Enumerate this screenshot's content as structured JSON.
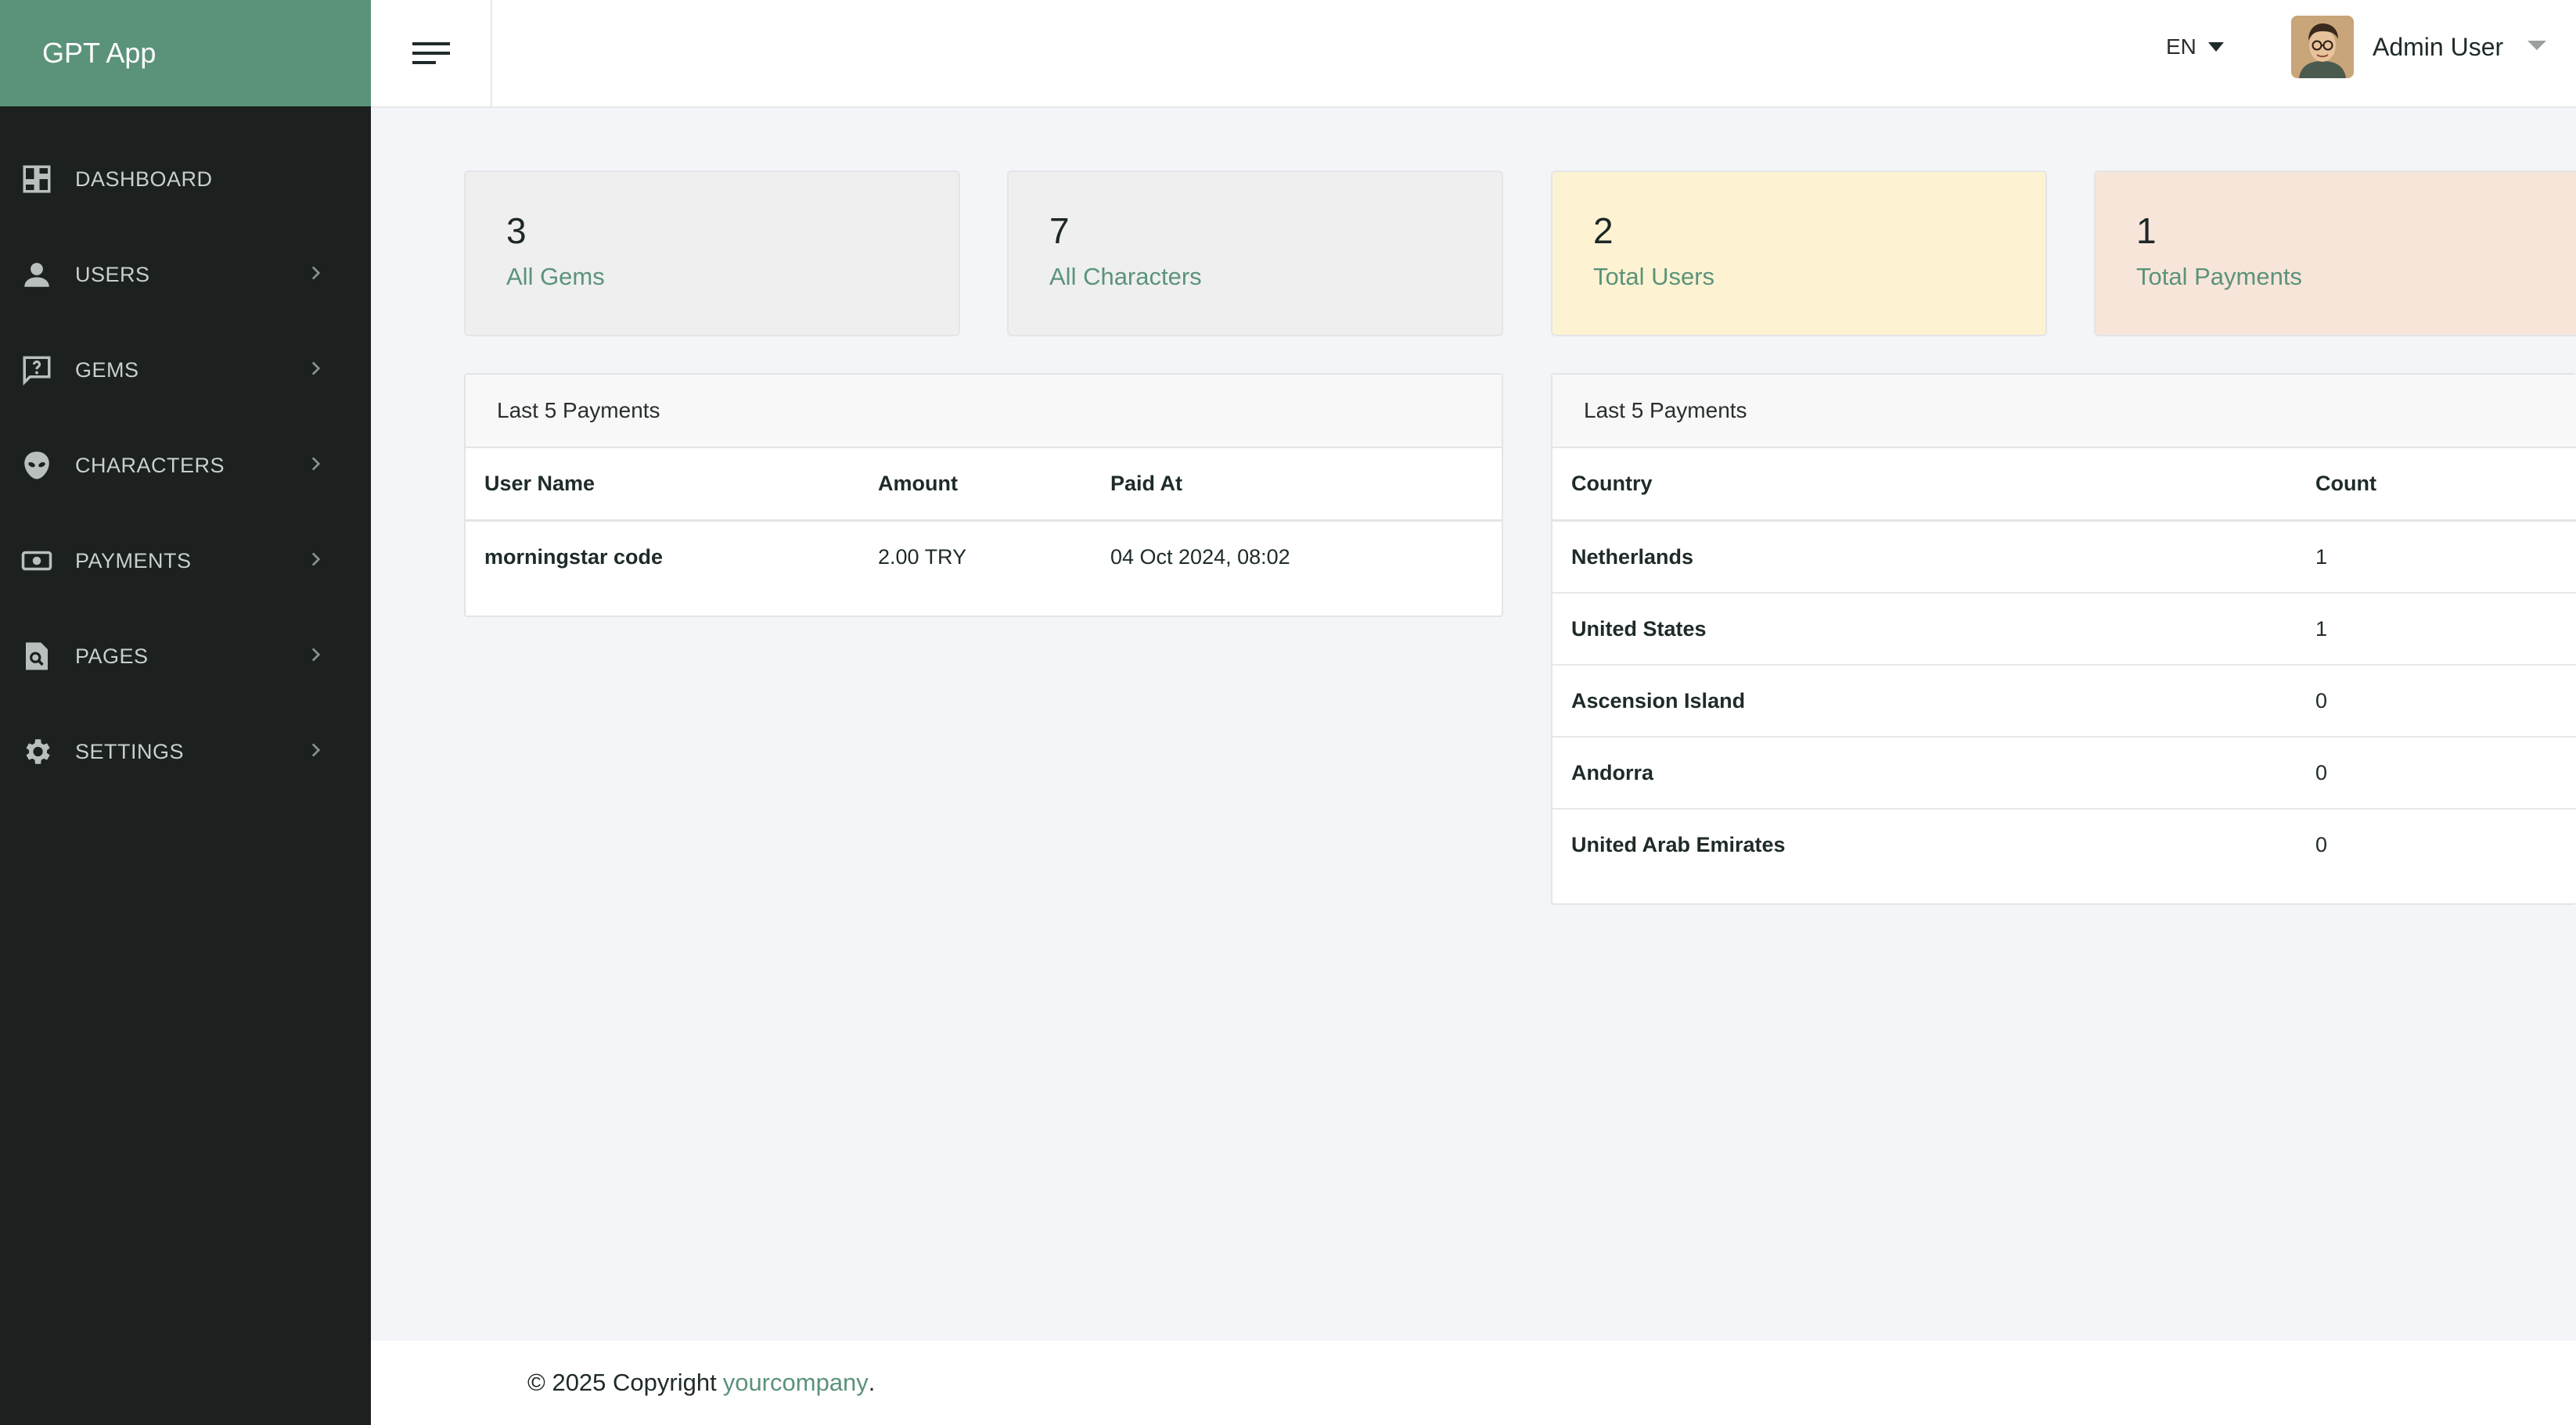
{
  "app": {
    "title": "GPT App"
  },
  "colors": {
    "brand": "#5b937a",
    "sidebar_bg": "#1c201e",
    "card_yellow": "#fdf3d2",
    "card_peach": "#f8e5da",
    "card_gray": "#efefef"
  },
  "sidebar": {
    "items": [
      {
        "label": "DASHBOARD",
        "icon": "dashboard-icon",
        "has_chevron": false
      },
      {
        "label": "USERS",
        "icon": "person-icon",
        "has_chevron": true
      },
      {
        "label": "GEMS",
        "icon": "help-chat-icon",
        "has_chevron": true
      },
      {
        "label": "CHARACTERS",
        "icon": "alien-face-icon",
        "has_chevron": true
      },
      {
        "label": "PAYMENTS",
        "icon": "money-icon",
        "has_chevron": true
      },
      {
        "label": "PAGES",
        "icon": "page-search-icon",
        "has_chevron": true
      },
      {
        "label": "SETTINGS",
        "icon": "gear-icon",
        "has_chevron": true
      }
    ]
  },
  "header": {
    "menu_icon": "menu-icon",
    "language": "EN",
    "user_name": "Admin User"
  },
  "stats": [
    {
      "value": "3",
      "label": "All Gems"
    },
    {
      "value": "7",
      "label": "All Characters"
    },
    {
      "value": "2",
      "label": "Total Users"
    },
    {
      "value": "1",
      "label": "Total Payments"
    }
  ],
  "payments_table": {
    "title": "Last 5 Payments",
    "columns": [
      "User Name",
      "Amount",
      "Paid At"
    ],
    "rows": [
      [
        "morningstar code",
        "2.00 TRY",
        "04 Oct 2024, 08:02"
      ]
    ]
  },
  "country_table": {
    "title": "Last 5 Payments",
    "columns": [
      "Country",
      "Count"
    ],
    "rows": [
      [
        "Netherlands",
        "1"
      ],
      [
        "United States",
        "1"
      ],
      [
        "Ascension Island",
        "0"
      ],
      [
        "Andorra",
        "0"
      ],
      [
        "United Arab Emirates",
        "0"
      ]
    ]
  },
  "footer": {
    "text": "© 2025 Copyright",
    "link": "yourcompany",
    "suffix": "."
  }
}
